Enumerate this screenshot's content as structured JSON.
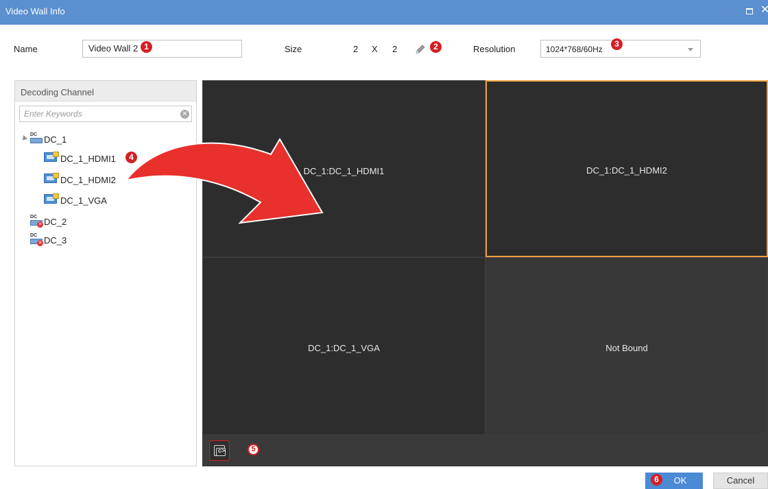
{
  "window": {
    "title": "Video Wall  Info"
  },
  "form": {
    "name_label": "Name",
    "name_value": "Video Wall 2",
    "size_label": "Size",
    "size_rows": "2",
    "size_x": "X",
    "size_cols": "2",
    "resolution_label": "Resolution",
    "resolution_value": "1024*768/60Hz"
  },
  "annotations": {
    "step1": "1",
    "step2": "2",
    "step3": "3",
    "step4": "4",
    "step5": "5",
    "step6": "6"
  },
  "channel_panel": {
    "title": "Decoding Channel",
    "search_placeholder": "Enter Keywords",
    "tree": {
      "dc1": "DC_1",
      "dc1_hdmi1": "DC_1_HDMI1",
      "dc1_hdmi2": "DC_1_HDMI2",
      "dc1_vga": "DC_1_VGA",
      "dc2": "DC_2",
      "dc3": "DC_3"
    },
    "device_badge": "DC"
  },
  "wall": {
    "cells": [
      {
        "label": "DC_1:DC_1_HDMI1"
      },
      {
        "label": "DC_1:DC_1_HDMI2"
      },
      {
        "label": "DC_1:DC_1_VGA"
      },
      {
        "label": "Not Bound"
      }
    ]
  },
  "footer": {
    "ok_label": "OK",
    "cancel_label": "Cancel"
  },
  "colors": {
    "titlebar": "#5b8fd0",
    "accent_red": "#d31f25",
    "selected_border": "#f0a040",
    "ok_button": "#4b8ad4"
  }
}
